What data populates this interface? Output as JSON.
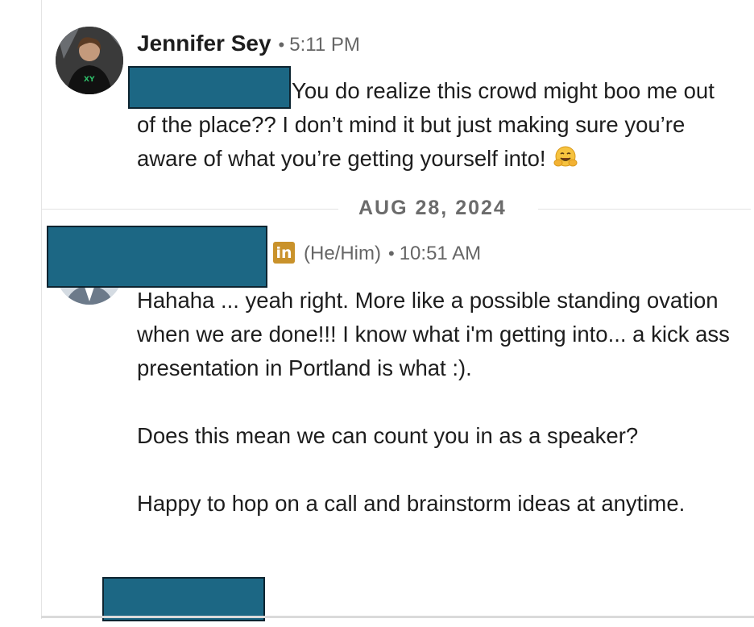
{
  "message1": {
    "sender_name": "Jennifer Sey",
    "separator": "•",
    "time": "5:11 PM",
    "text": "You do realize this crowd might boo me out of the place?? I don’t mind it but just making sure you’re aware of what you’re getting yourself into!",
    "emoji": "hugging-face-emoji"
  },
  "date_divider": {
    "label": "AUG 28, 2024"
  },
  "message2": {
    "linkedin_badge": "in",
    "pronouns": "(He/Him)",
    "separator": "•",
    "time": "10:51 AM",
    "paragraphs": [
      "Hahaha ... yeah right. More like a possible standing ovation when we are done!!! I know what i'm getting into... a kick ass presentation in Portland is what :).",
      "Does this mean we can count you in as a speaker?",
      "Happy to hop on a call and brainstorm ideas at anytime."
    ]
  },
  "colors": {
    "redaction_fill": "#1c6784",
    "redaction_border": "#0d2430",
    "linkedin_badge": "#c9922b",
    "meta_text": "#666666"
  }
}
